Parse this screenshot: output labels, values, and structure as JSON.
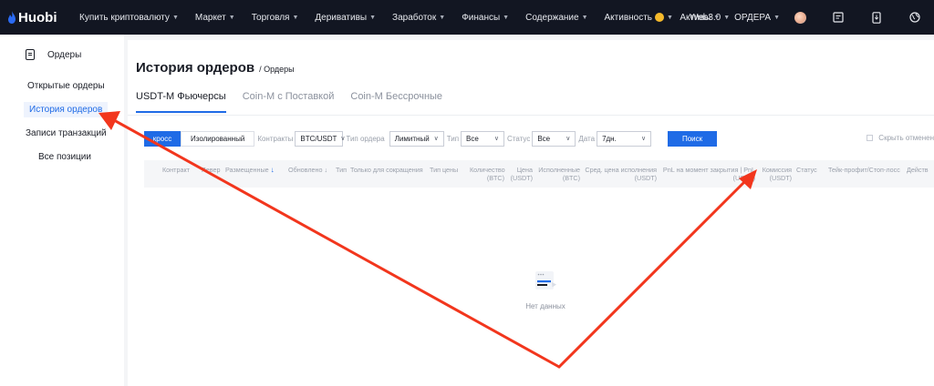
{
  "topbar": {
    "logo": "Huobi",
    "nav": [
      {
        "label": "Купить криптовалюту"
      },
      {
        "label": "Маркет"
      },
      {
        "label": "Торговля"
      },
      {
        "label": "Деривативы"
      },
      {
        "label": "Заработок"
      },
      {
        "label": "Финансы"
      },
      {
        "label": "Содержание"
      },
      {
        "label": "Активность"
      },
      {
        "label": "Web3.0"
      }
    ],
    "assets_label": "Активы",
    "orders_label": "ОРДЕРА"
  },
  "sidebar": {
    "header": "Ордеры",
    "items": [
      {
        "label": "Открытые ордеры"
      },
      {
        "label": "История ордеров"
      },
      {
        "label": "Записи транзакций"
      },
      {
        "label": "Все позиции"
      }
    ]
  },
  "main": {
    "title": "История ордеров",
    "breadcrumb": "/ Ордеры",
    "tabs": [
      {
        "label": "USDT-M Фьючерсы"
      },
      {
        "label": "Coin-M с Поставкой"
      },
      {
        "label": "Coin-M Бессрочные"
      }
    ]
  },
  "filters": {
    "margin_cross": "кросс",
    "margin_isolated": "Изолированный",
    "contracts_label": "Контракты",
    "contracts_value": "BTC/USDT",
    "order_type_label": "Тип ордера",
    "order_type_value": "Лимитный",
    "type_label": "Тип",
    "type_value": "Все",
    "status_label": "Статус",
    "status_value": "Все",
    "date_label": "Дата",
    "date_value": "7дн.",
    "search_button": "Поиск",
    "hide_cancelled": "Скрыть отменен"
  },
  "table": {
    "columns": {
      "contract": "Контракт",
      "leverage": "Левер",
      "placed": "Размещенные",
      "updated": "Обновлено",
      "type": "Тип",
      "close_only": "Только для сокращения",
      "price_type": "Тип цены",
      "quantity": "Количество",
      "quantity_unit": "(BTC)",
      "price": "Цена",
      "price_unit": "(USDT)",
      "executed": "Исполненные",
      "executed_unit": "(BTC)",
      "avg_price": "Сред. цена исполнения",
      "avg_price_unit": "(USDT)",
      "pnl": "PnL на момент закрытия | PnL",
      "pnl_unit": "(USDT)",
      "fee": "Комиссия",
      "fee_unit": "(USDT)",
      "status": "Статус",
      "tp_sl": "Тейк-профит/Стоп-лосс",
      "action": "Действ"
    },
    "empty_text": "Нет данных"
  },
  "colors": {
    "accent": "#1f6be6",
    "topbar_bg": "#121622",
    "annotation_arrow": "#f2361d"
  }
}
